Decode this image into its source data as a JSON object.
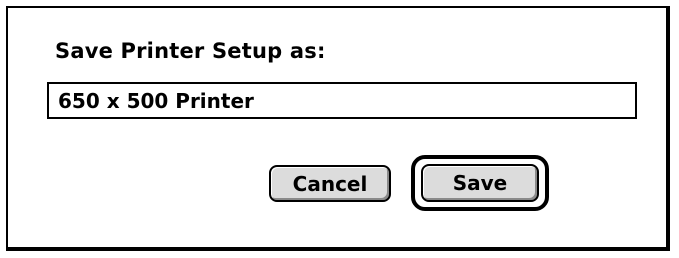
{
  "dialog": {
    "prompt": "Save Printer Setup as:",
    "name_field": {
      "value": "650 x 500 Printer"
    },
    "buttons": {
      "cancel": "Cancel",
      "save": "Save"
    },
    "default_button": "save"
  }
}
